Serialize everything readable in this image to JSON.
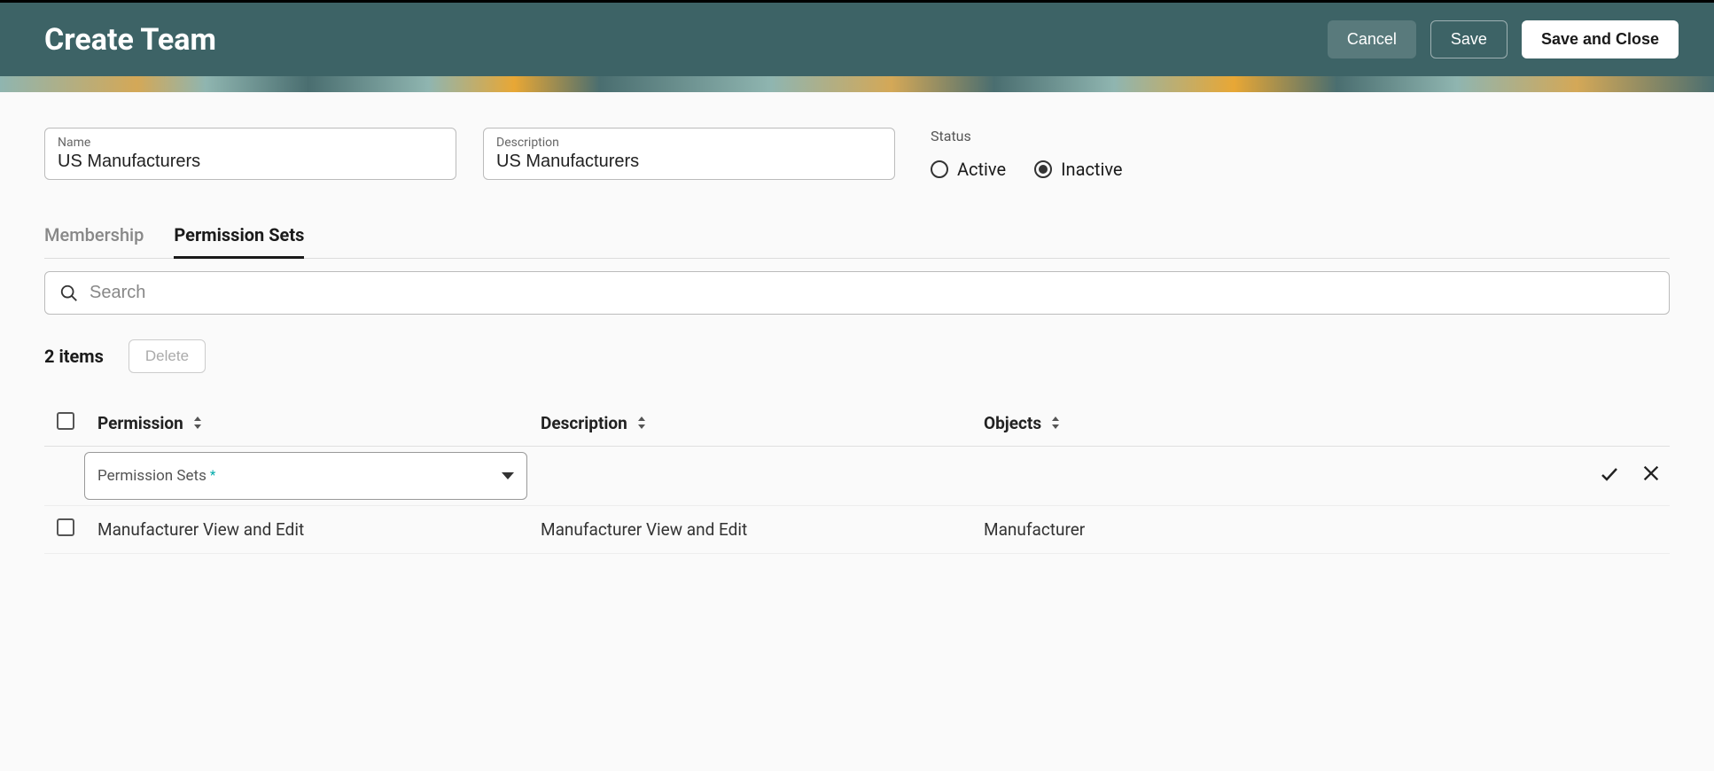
{
  "header": {
    "title": "Create Team",
    "buttons": {
      "cancel": "Cancel",
      "save": "Save",
      "save_close": "Save and Close"
    }
  },
  "form": {
    "name": {
      "label": "Name",
      "value": "US Manufacturers"
    },
    "description": {
      "label": "Description",
      "value": "US Manufacturers"
    },
    "status": {
      "label": "Status",
      "options": {
        "active": "Active",
        "inactive": "Inactive"
      },
      "selected": "inactive"
    }
  },
  "tabs": {
    "membership": "Membership",
    "permission_sets": "Permission Sets"
  },
  "search": {
    "placeholder": "Search"
  },
  "list": {
    "count_text": "2 items",
    "delete_label": "Delete"
  },
  "table": {
    "headers": {
      "permission": "Permission",
      "description": "Description",
      "objects": "Objects"
    },
    "edit_row": {
      "dropdown_label": "Permission Sets"
    },
    "rows": [
      {
        "permission": "Manufacturer View and Edit",
        "description": "Manufacturer View and Edit",
        "objects": "Manufacturer"
      }
    ]
  }
}
